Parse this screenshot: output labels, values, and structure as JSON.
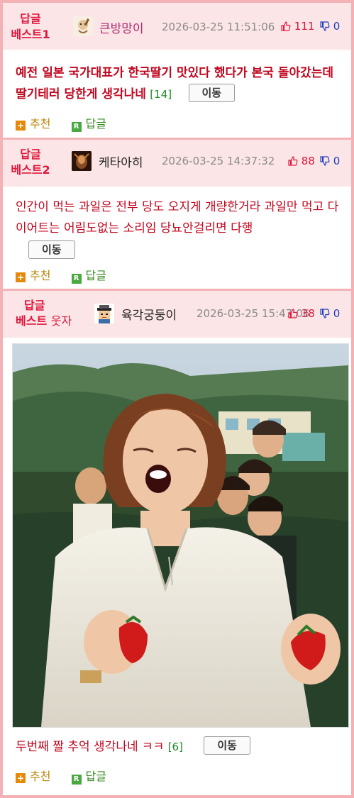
{
  "posts": [
    {
      "best_line1": "답글",
      "best_line2": "베스트1",
      "nickname": "큰방망이",
      "datetime": "2026-03-25 11:51:06",
      "up": "111",
      "down": "0",
      "text": "예전 일본 국가대표가 한국딸기 맛있다 했다가 본국 돌아갔는데 딸기테러 당한게 생각나네",
      "count": "[14]",
      "move_label": "이동",
      "recommend_label": "추천",
      "reply_label": "답글"
    },
    {
      "best_line1": "답글",
      "best_line2": "베스트2",
      "nickname": "케타아히",
      "datetime": "2026-03-25 14:37:32",
      "up": "88",
      "down": "0",
      "text": "인간이 먹는 과일은 전부 당도 오지게 개량한거라 과일만 먹고 다이어트는 어림도없는 소리임 당뇨안걸리면 다행",
      "move_label": "이동",
      "recommend_label": "추천",
      "reply_label": "답글"
    },
    {
      "best_line1": "답글",
      "best_line2": "베스트",
      "best_extra": "웃자",
      "nickname": "육각궁둥이",
      "datetime": "2026-03-25 15:47:06",
      "up": "38",
      "down": "0",
      "text": "두번째 짤 추억 생각나네 ㅋㅋ",
      "count": "[6]",
      "move_label": "이동",
      "recommend_label": "추천",
      "reply_label": "답글"
    }
  ],
  "colors": {
    "border": "#f3b2b6",
    "header_bg": "#fce5e7",
    "best": "#e0173c",
    "up": "#e0173c",
    "down": "#1d3fbf"
  },
  "icons": [
    "thumbs-up-icon",
    "thumbs-down-icon",
    "plus-icon",
    "reply-r-icon"
  ]
}
